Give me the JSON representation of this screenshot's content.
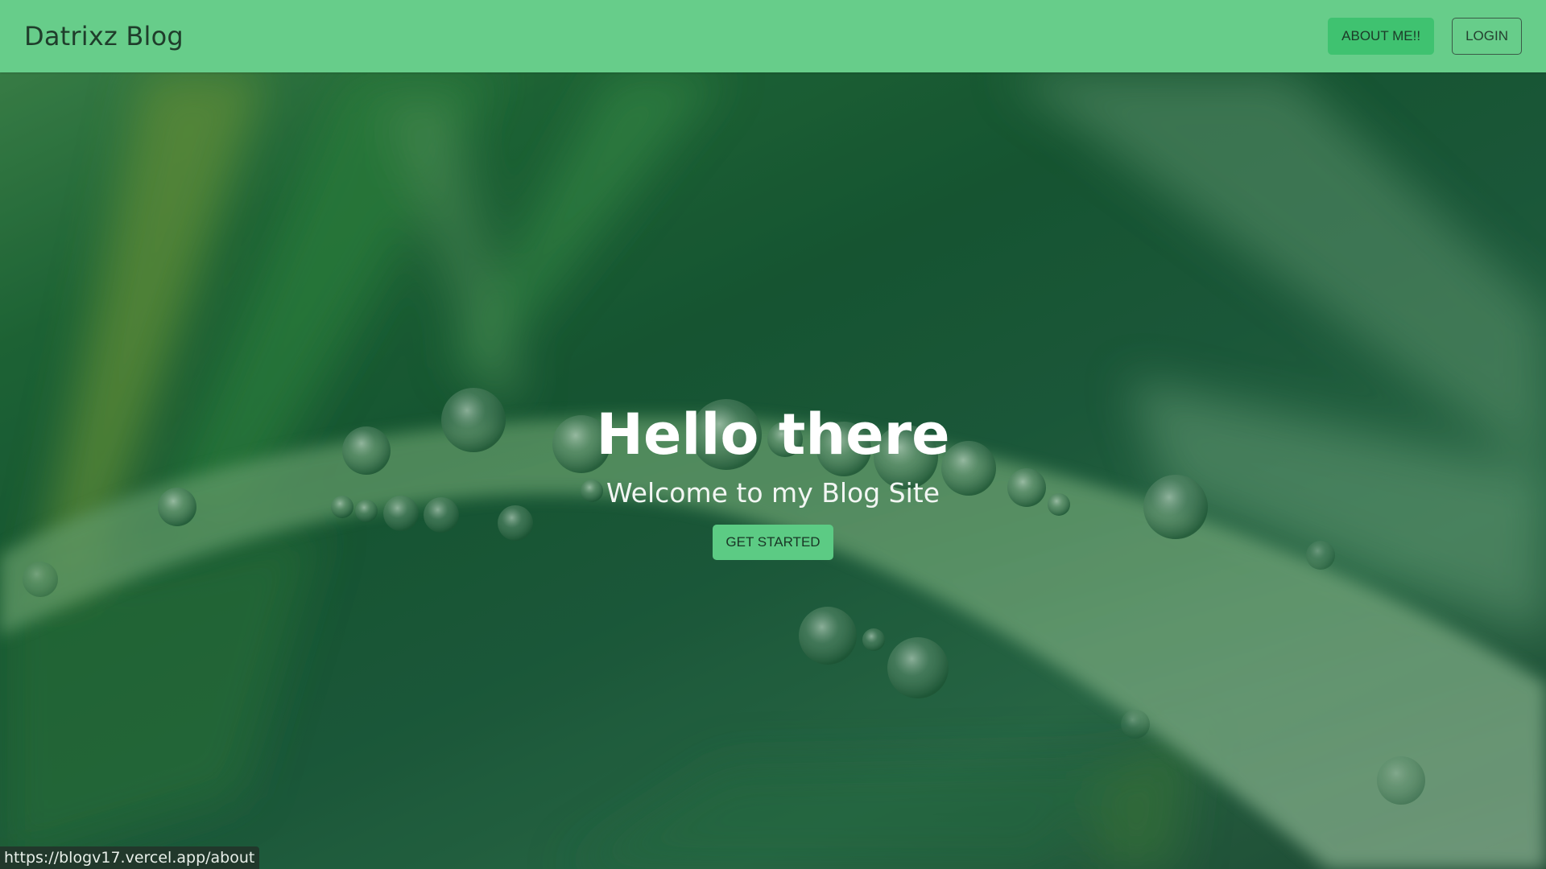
{
  "navbar": {
    "brand": "Datrixz Blog",
    "about_label": "ABOUT ME!!",
    "login_label": "LOGIN"
  },
  "hero": {
    "title": "Hello there",
    "subtitle": "Welcome to my Blog Site",
    "cta_label": "GET STARTED"
  },
  "status_bar": {
    "url": "https://blogv17.vercel.app/about"
  },
  "colors": {
    "navbar_bg": "#67cd8a",
    "accent_button": "#3fc270",
    "cta_button": "#5ccb84",
    "hero_text": "#ffffff"
  }
}
